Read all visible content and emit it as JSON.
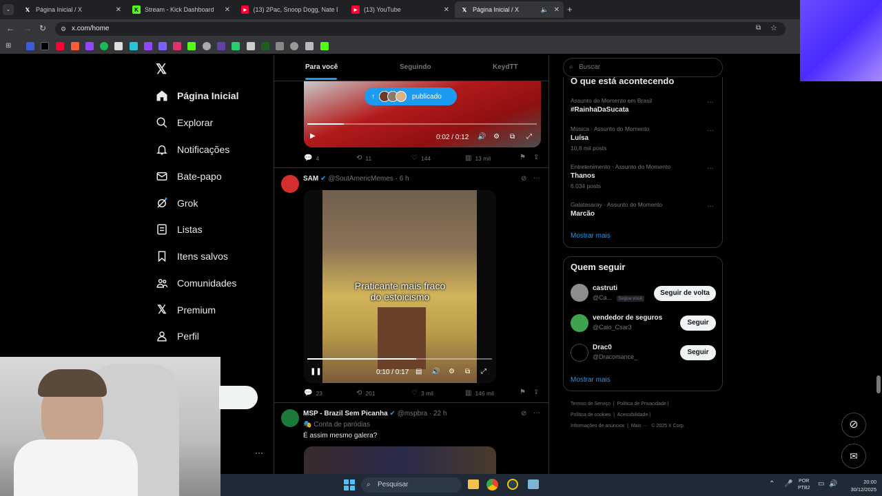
{
  "browser": {
    "tabs": [
      {
        "title": "Página Inicial / X",
        "favicon": "x-icon"
      },
      {
        "title": "Stream - Kick Dashboard",
        "favicon": "kick-icon"
      },
      {
        "title": "(13) 2Pac, Snoop Dogg, Nate D...",
        "favicon": "youtube-icon"
      },
      {
        "title": "(13) YouTube",
        "favicon": "youtube-icon"
      },
      {
        "title": "Página Inicial / X",
        "favicon": "x-icon",
        "active": true
      }
    ],
    "url": "x.com/home"
  },
  "nav": {
    "items": [
      {
        "label": "Página Inicial",
        "icon": "home-icon",
        "bold": true
      },
      {
        "label": "Explorar",
        "icon": "search-icon"
      },
      {
        "label": "Notificações",
        "icon": "bell-icon"
      },
      {
        "label": "Bate-papo",
        "icon": "mail-icon"
      },
      {
        "label": "Grok",
        "icon": "grok-icon"
      },
      {
        "label": "Listas",
        "icon": "list-icon"
      },
      {
        "label": "Itens salvos",
        "icon": "bookmark-icon"
      },
      {
        "label": "Comunidades",
        "icon": "people-icon"
      },
      {
        "label": "Premium",
        "icon": "x-icon"
      },
      {
        "label": "Perfil",
        "icon": "person-icon"
      }
    ]
  },
  "feed": {
    "tabs": [
      "Para você",
      "Seguindo",
      "KeydTT"
    ],
    "posted_badge": "publicado",
    "tweet1": {
      "video_time": "0:02 / 0:12",
      "replies": "4",
      "retweets": "11",
      "likes": "144",
      "views": "13 mil"
    },
    "tweet2": {
      "name": "SAM",
      "handle": "@SoutAmericMemes",
      "time": "6 h",
      "caption_line1": "Praticante mais fraco",
      "caption_line2": "do estoicismo",
      "video_time": "0:10 / 0:17",
      "replies": "23",
      "retweets": "201",
      "likes": "3 mil",
      "views": "146 mil"
    },
    "tweet3": {
      "name": "MSP - Brazil Sem Picanha",
      "handle": "@mspbra",
      "time": "22 h",
      "label": "Conta de paródias",
      "text": "É assim mesmo galera?"
    }
  },
  "right": {
    "search_placeholder": "Buscar",
    "trends_title": "O que está acontecendo",
    "trends": [
      {
        "category": "Assunto do Momento em Brasil",
        "name": "#RainhaDaSucata",
        "posts": ""
      },
      {
        "category": "Música · Assunto do Momento",
        "name": "Luísa",
        "posts": "10,8 mil posts"
      },
      {
        "category": "Entretenimento · Assunto do Momento",
        "name": "Thanos",
        "posts": "6.034 posts"
      },
      {
        "category": "Galatasaray · Assunto do Momento",
        "name": "Marcão",
        "posts": ""
      }
    ],
    "show_more": "Mostrar mais",
    "follow_title": "Quem seguir",
    "follow": [
      {
        "name": "castruti",
        "handle": "@Ca...",
        "badge": "Segue você",
        "button": "Seguir de volta"
      },
      {
        "name": "vendedor de seguros",
        "handle": "@Caio_Csar3",
        "badge": "",
        "button": "Seguir"
      },
      {
        "name": "Drac0",
        "handle": "@Dracomance_",
        "badge": "",
        "button": "Seguir"
      }
    ],
    "footer": {
      "line1": [
        "Termos de Serviço",
        "Política de Privacidade"
      ],
      "line2": [
        "Política de cookies",
        "Acessibilidade"
      ],
      "line3": [
        "Informações de anúncios",
        "Mais ···",
        "© 2025 X Corp."
      ]
    }
  },
  "taskbar": {
    "search": "Pesquisar",
    "lang1": "POR",
    "lang2": "PTB2",
    "time": "20:00",
    "date": "30/12/2025"
  },
  "colors": {
    "accent": "#1d9bf0",
    "bg": "#000000",
    "border": "#2f3336"
  }
}
